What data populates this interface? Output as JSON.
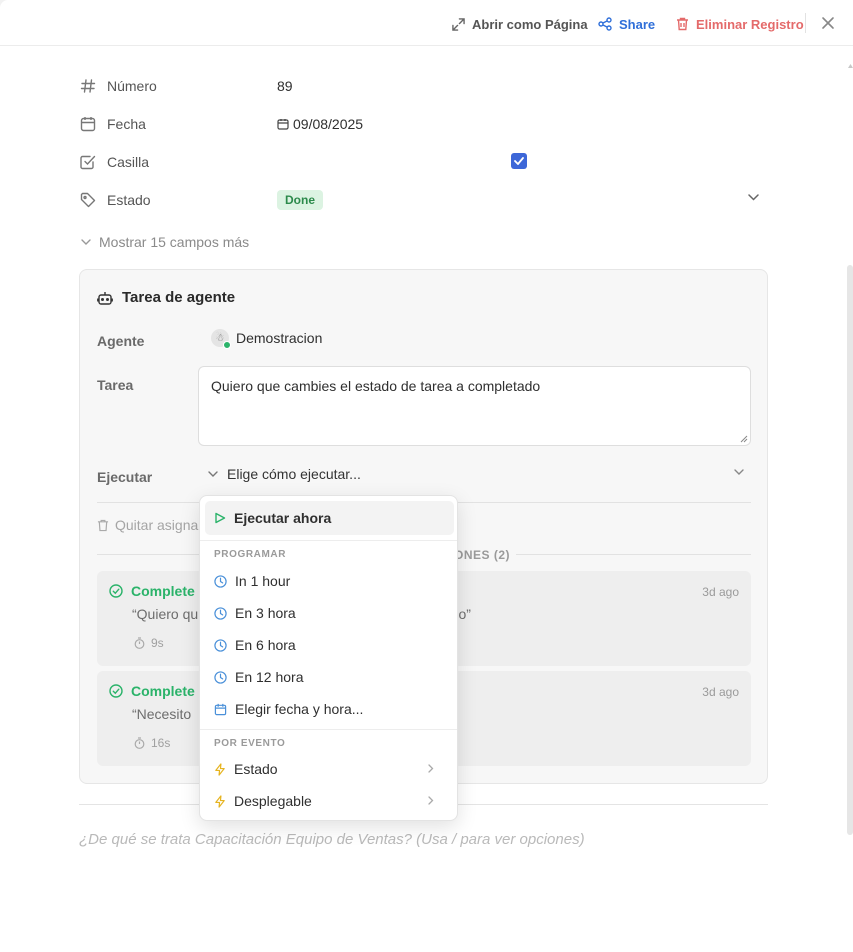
{
  "toolbar": {
    "open_page": "Abrir como Página",
    "share": "Share",
    "delete": "Eliminar Registro"
  },
  "properties": [
    {
      "label": "Número",
      "value": "89",
      "icon": "hash-icon"
    },
    {
      "label": "Fecha",
      "value": "09/08/2025",
      "icon": "calendar-icon"
    },
    {
      "label": "Casilla",
      "checked": true,
      "icon": "checkbox-icon"
    },
    {
      "label": "Estado",
      "value": "Done",
      "icon": "tag-icon"
    }
  ],
  "more_fields": "Mostrar 15 campos más",
  "agent_task": {
    "title": "Tarea de agente",
    "agent_label": "Agente",
    "agent_name": "Demostracion",
    "task_label": "Tarea",
    "task_text": "Quiero que cambies el estado de tarea a completado",
    "execute_label": "Ejecutar",
    "execute_placeholder": "Elige cómo ejecutar...",
    "remove_label": "Quitar asigna",
    "executions_header": "CIONES (2)",
    "executions": [
      {
        "status": "Complete",
        "ago": "3d ago",
        "quote_start": "“Quiero qu",
        "quote_end": "tado”",
        "duration": "9s"
      },
      {
        "status": "Complete",
        "ago": "3d ago",
        "quote_start": "“Necesito",
        "quote_end": "",
        "duration": "16s"
      }
    ]
  },
  "menu": {
    "run_now": "Ejecutar ahora",
    "schedule_header": "PROGRAMAR",
    "schedule_items": [
      "In 1 hour",
      "En 3 hora",
      "En 6 hora",
      "En 12 hora"
    ],
    "pick_datetime": "Elegir fecha y hora...",
    "event_header": "POR EVENTO",
    "event_items": [
      "Estado",
      "Desplegable"
    ]
  },
  "editor_placeholder": "¿De qué se trata Capacitación Equipo de Ventas? (Usa / para ver opciones)",
  "colors": {
    "accent_blue": "#2f6fd9",
    "danger": "#e46a6a",
    "success": "#2bb36a",
    "checkbox": "#3d67d8"
  }
}
